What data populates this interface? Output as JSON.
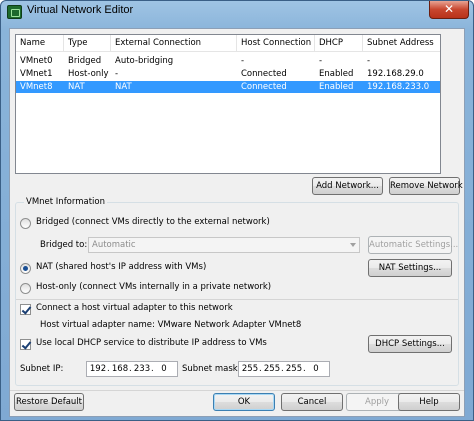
{
  "window": {
    "title": "Virtual Network Editor",
    "close_glyph": "✕",
    "title_icon": "network-editor-icon"
  },
  "table": {
    "columns": [
      "Name",
      "Type",
      "External Connection",
      "Host Connection",
      "DHCP",
      "Subnet Address"
    ],
    "rows": [
      {
        "name": "VMnet0",
        "type": "Bridged",
        "external": "Auto-bridging",
        "host": "-",
        "dhcp": "-",
        "subnet": "-"
      },
      {
        "name": "VMnet1",
        "type": "Host-only",
        "external": "-",
        "host": "Connected",
        "dhcp": "Enabled",
        "subnet": "192.168.29.0"
      },
      {
        "name": "VMnet8",
        "type": "NAT",
        "external": "NAT",
        "host": "Connected",
        "dhcp": "Enabled",
        "subnet": "192.168.233.0"
      }
    ],
    "selected_index": 2,
    "selection_color": "#3399ff"
  },
  "buttons": {
    "add_network": "Add Network...",
    "remove_network": "Remove Network",
    "automatic_settings": "Automatic Settings...",
    "nat_settings": "NAT Settings...",
    "dhcp_settings": "DHCP Settings...",
    "restore_default": "Restore Default",
    "ok": "OK",
    "cancel": "Cancel",
    "apply": "Apply",
    "help": "Help"
  },
  "vmnet_info": {
    "group_label": "VMnet Information",
    "bridged_label": "Bridged (connect VMs directly to the external network)",
    "bridged_to_label": "Bridged to:",
    "bridged_to_value": "Automatic",
    "nat_label": "NAT (shared host's IP address with VMs)",
    "hostonly_label": "Host-only (connect VMs internally in a private network)",
    "selected_mode": "nat",
    "connect_host_adapter_label": "Connect a host virtual adapter to this network",
    "connect_host_adapter_checked": true,
    "host_adapter_name_label": "Host virtual adapter name: VMware Network Adapter VMnet8",
    "use_dhcp_label": "Use local DHCP service to distribute IP address to VMs",
    "use_dhcp_checked": true
  },
  "subnet": {
    "ip_label": "Subnet IP:",
    "ip": [
      "192",
      "168",
      "233",
      "0"
    ],
    "mask_label": "Subnet mask:",
    "mask": [
      "255",
      "255",
      "255",
      "0"
    ]
  }
}
